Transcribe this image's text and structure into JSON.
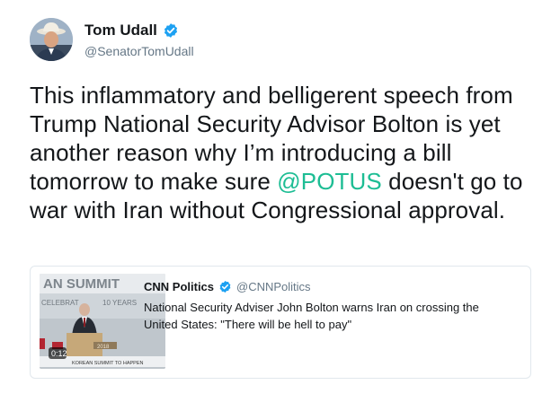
{
  "author": {
    "display_name": "Tom Udall",
    "handle": "@SenatorTomUdall",
    "verified_color": "#1da1f2",
    "avatar_icon": "user-avatar"
  },
  "tweet": {
    "text_before": "This inflammatory and belligerent speech from Trump National Security Advisor Bolton is yet another reason why I’m introducing a bill tomorrow to make sure ",
    "mention": "@POTUS",
    "text_after": " doesn't go to war with Iran without Congressional approval."
  },
  "quoted": {
    "display_name": "CNN Politics",
    "handle": "@CNNPolitics",
    "text": "National Security Adviser John Bolton warns Iran on crossing the United States: \"There will be hell to pay\"",
    "media": {
      "banner_top": "AN SUMMIT",
      "banner_sub": "CELEBRAT",
      "banner_years": "10 YEARS",
      "podium_year": "2018",
      "ticker": "KOREAN SUMMIT TO HAPPEN",
      "timestamp": "0:12"
    }
  }
}
